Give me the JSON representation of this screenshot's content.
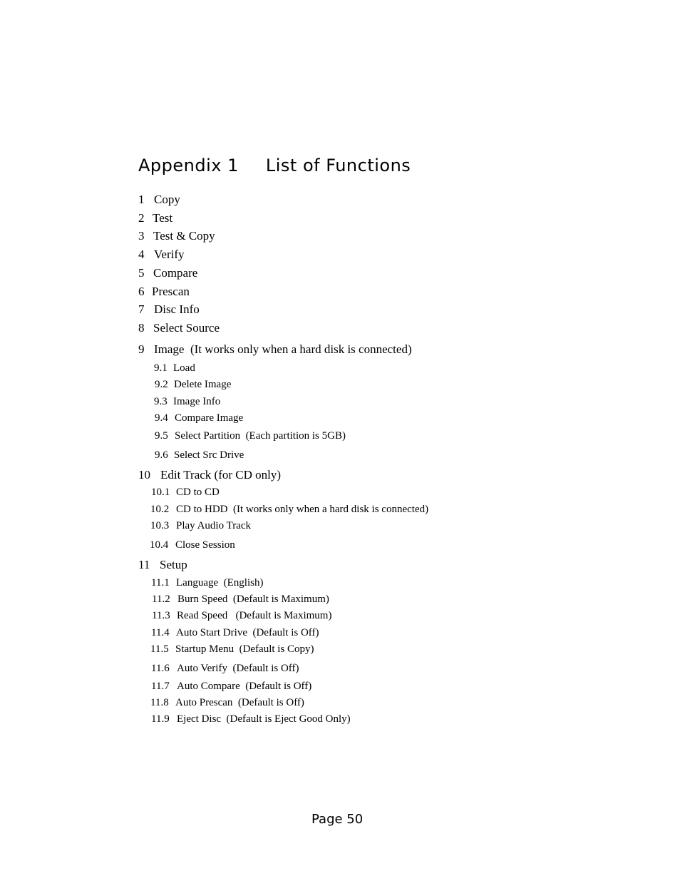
{
  "title": {
    "part1": "Appendix 1",
    "part2": "List of Functions"
  },
  "items": [
    {
      "num": "1",
      "label": "Copy"
    },
    {
      "num": "2",
      "label": "Test"
    },
    {
      "num": "3",
      "label": "Test & Copy"
    },
    {
      "num": "4",
      "label": "Verify"
    },
    {
      "num": "5",
      "label": "Compare"
    },
    {
      "num": "6",
      "label": "Prescan"
    },
    {
      "num": "7",
      "label": "Disc Info"
    },
    {
      "num": "8",
      "label": "Select Source"
    },
    {
      "num": "9",
      "label": "Image  (It works only when a hard disk is connected)"
    },
    {
      "num": "9.1",
      "label": "Load"
    },
    {
      "num": "9.2",
      "label": "Delete Image"
    },
    {
      "num": "9.3",
      "label": "Image Info"
    },
    {
      "num": "9.4",
      "label": "Compare Image"
    },
    {
      "num": "9.5",
      "label": "Select Partition  (Each partition is 5GB)"
    },
    {
      "num": "9.6",
      "label": "Select Src Drive"
    },
    {
      "num": "10",
      "label": "Edit Track (for CD only)"
    },
    {
      "num": "10.1",
      "label": "CD to CD"
    },
    {
      "num": "10.2",
      "label": "CD to HDD  (It works only when a hard disk is connected)"
    },
    {
      "num": "10.3",
      "label": "Play Audio Track"
    },
    {
      "num": "10.4",
      "label": "Close Session"
    },
    {
      "num": "11",
      "label": "Setup"
    },
    {
      "num": "11.1",
      "label": "Language  (English)"
    },
    {
      "num": "11.2",
      "label": "Burn Speed  (Default is Maximum)"
    },
    {
      "num": "11.3",
      "label": "Read Speed   (Default is Maximum)"
    },
    {
      "num": "11.4",
      "label": "Auto Start Drive  (Default is Off)"
    },
    {
      "num": "11.5",
      "label": "Startup Menu  (Default is Copy)"
    },
    {
      "num": "11.6",
      "label": "Auto Verify  (Default is Off)"
    },
    {
      "num": "11.7",
      "label": "Auto Compare  (Default is Off)"
    },
    {
      "num": "11.8",
      "label": "Auto Prescan  (Default is Off)"
    },
    {
      "num": "11.9",
      "label": "Eject Disc  (Default is Eject Good Only)"
    }
  ],
  "footer": {
    "page_label": "Page 50"
  }
}
